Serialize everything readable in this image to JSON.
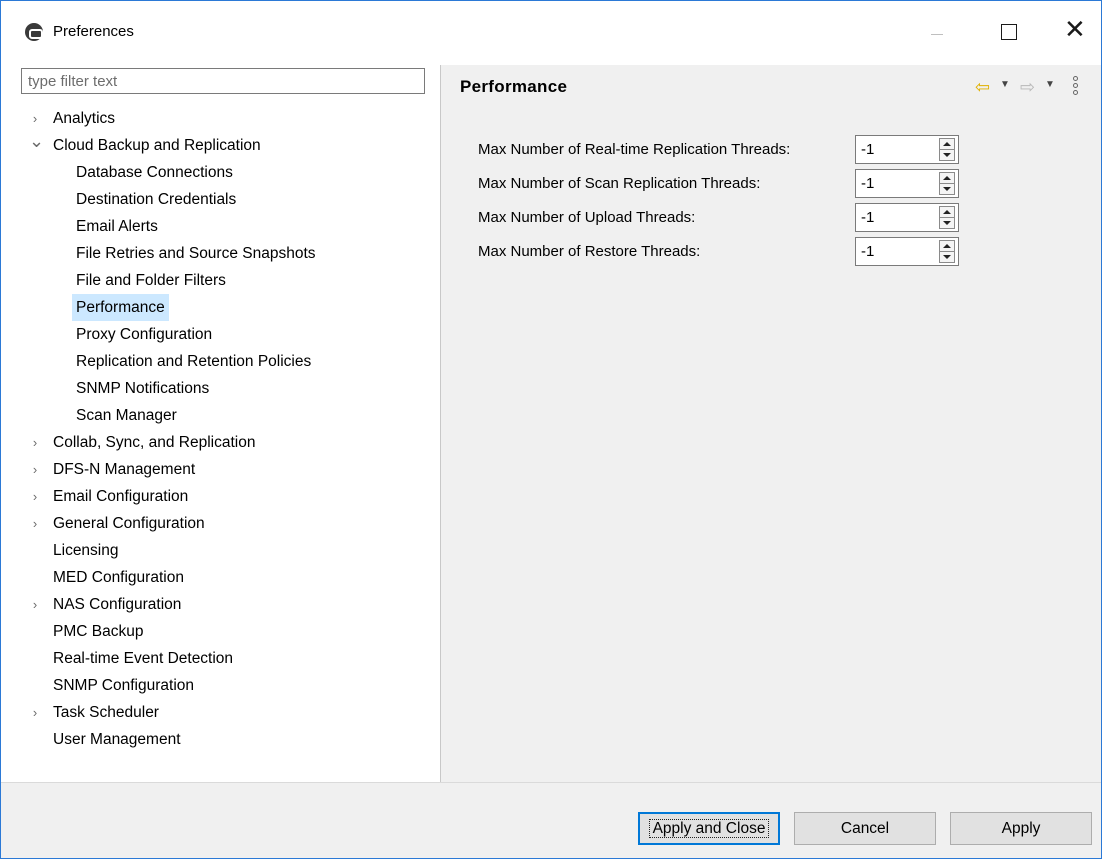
{
  "window": {
    "title": "Preferences"
  },
  "filter": {
    "placeholder": "type filter text"
  },
  "tree": {
    "items": [
      {
        "label": "Analytics",
        "level": 0,
        "expandable": true,
        "expanded": false
      },
      {
        "label": "Cloud Backup and Replication",
        "level": 0,
        "expandable": true,
        "expanded": true
      },
      {
        "label": "Database Connections",
        "level": 1
      },
      {
        "label": "Destination Credentials",
        "level": 1
      },
      {
        "label": "Email Alerts",
        "level": 1
      },
      {
        "label": "File Retries and Source Snapshots",
        "level": 1
      },
      {
        "label": "File and Folder Filters",
        "level": 1
      },
      {
        "label": "Performance",
        "level": 1,
        "selected": true
      },
      {
        "label": "Proxy Configuration",
        "level": 1
      },
      {
        "label": "Replication and Retention Policies",
        "level": 1
      },
      {
        "label": "SNMP Notifications",
        "level": 1
      },
      {
        "label": "Scan Manager",
        "level": 1
      },
      {
        "label": "Collab, Sync, and Replication",
        "level": 0,
        "expandable": true,
        "expanded": false
      },
      {
        "label": "DFS-N Management",
        "level": 0,
        "expandable": true,
        "expanded": false
      },
      {
        "label": "Email Configuration",
        "level": 0,
        "expandable": true,
        "expanded": false
      },
      {
        "label": "General Configuration",
        "level": 0,
        "expandable": true,
        "expanded": false
      },
      {
        "label": "Licensing",
        "level": 0
      },
      {
        "label": "MED Configuration",
        "level": 0
      },
      {
        "label": "NAS Configuration",
        "level": 0,
        "expandable": true,
        "expanded": false
      },
      {
        "label": "PMC Backup",
        "level": 0
      },
      {
        "label": "Real-time Event Detection",
        "level": 0
      },
      {
        "label": "SNMP Configuration",
        "level": 0
      },
      {
        "label": "Task Scheduler",
        "level": 0,
        "expandable": true,
        "expanded": false
      },
      {
        "label": "User Management",
        "level": 0
      }
    ]
  },
  "page": {
    "title": "Performance",
    "fields": [
      {
        "label": "Max Number of Real-time Replication Threads:",
        "value": "-1"
      },
      {
        "label": "Max Number of Scan Replication Threads:",
        "value": "-1"
      },
      {
        "label": "Max Number of Upload Threads:",
        "value": "-1"
      },
      {
        "label": "Max Number of Restore Threads:",
        "value": "-1"
      }
    ]
  },
  "icons": {
    "back": "arrow-left-icon",
    "forward": "arrow-right-icon",
    "menu": "vertical-dots-icon",
    "accent_color": "#e0b100"
  },
  "buttons": {
    "apply_close": "Apply and Close",
    "cancel": "Cancel",
    "apply": "Apply"
  }
}
